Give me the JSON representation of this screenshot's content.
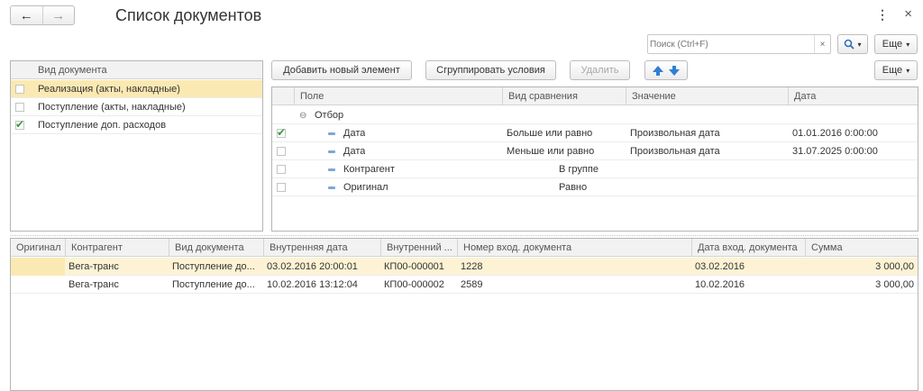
{
  "header": {
    "title": "Список документов",
    "back_icon": "←",
    "forward_icon": "→",
    "menu_icon": "⋮",
    "close_icon": "×"
  },
  "search": {
    "placeholder": "Поиск (Ctrl+F)",
    "clear_icon": "×",
    "search_icon": "🔍",
    "more_label": "Еще"
  },
  "doc_types": {
    "header": "Вид документа",
    "items": [
      {
        "label": "Реализация (акты, накладные)",
        "checked": false,
        "selected": true
      },
      {
        "label": "Поступление (акты, накладные)",
        "checked": false,
        "selected": false
      },
      {
        "label": "Поступление доп. расходов",
        "checked": true,
        "selected": false
      }
    ]
  },
  "filter_toolbar": {
    "add_label": "Добавить новый элемент",
    "group_label": "Сгруппировать условия",
    "delete_label": "Удалить",
    "more_label": "Еще"
  },
  "filter_table": {
    "headers": [
      "Поле",
      "Вид сравнения",
      "Значение",
      "Дата"
    ],
    "group_label": "Отбор",
    "group_icon": "⊖",
    "rows": [
      {
        "checked": true,
        "field": "Дата",
        "comparison": "Больше или равно",
        "value": "Произвольная дата",
        "date": "01.01.2016 0:00:00"
      },
      {
        "checked": false,
        "field": "Дата",
        "comparison": "Меньше или равно",
        "value": "Произвольная дата",
        "date": "31.07.2025 0:00:00"
      },
      {
        "checked": false,
        "field": "Контрагент",
        "comparison": "В группе",
        "value": "",
        "date": ""
      },
      {
        "checked": false,
        "field": "Оригинал",
        "comparison": "Равно",
        "value": "",
        "date": ""
      }
    ]
  },
  "documents": {
    "headers": [
      "Оригинал",
      "Контрагент",
      "Вид документа",
      "Внутренняя дата",
      "Внутренний ...",
      "Номер вход. документа",
      "Дата вход. документа",
      "Сумма"
    ],
    "rows": [
      {
        "original": "",
        "counterparty": "Вега-транс",
        "doc_type": "Поступление до...",
        "internal_date": "03.02.2016 20:00:01",
        "internal_no": "КП00-000001",
        "in_no": "1228",
        "in_date": "03.02.2016",
        "sum": "3 000,00"
      },
      {
        "original": "",
        "counterparty": "Вега-транс",
        "doc_type": "Поступление до...",
        "internal_date": "10.02.2016 13:12:04",
        "internal_no": "КП00-000002",
        "in_no": "2589",
        "in_date": "10.02.2016",
        "sum": "3 000,00"
      }
    ]
  },
  "colors": {
    "selection": "#fbe9b3",
    "accent_blue": "#2f7fd6",
    "check_green": "#3a9a3a"
  }
}
